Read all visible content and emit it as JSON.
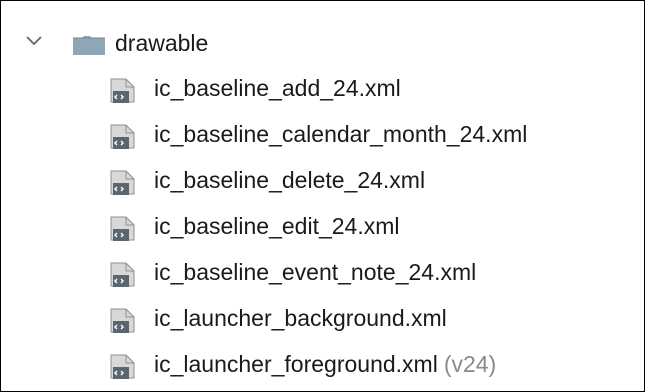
{
  "project_tree": {
    "folder": {
      "expanded": true,
      "label": "drawable",
      "chevron_icon": "chevron-down-icon",
      "folder_icon": "folder-icon"
    },
    "files": [
      {
        "label": "ic_baseline_add_24.xml",
        "icon": "xml-file-icon",
        "qualifier": ""
      },
      {
        "label": "ic_baseline_calendar_month_24.xml",
        "icon": "xml-file-icon",
        "qualifier": ""
      },
      {
        "label": "ic_baseline_delete_24.xml",
        "icon": "xml-file-icon",
        "qualifier": ""
      },
      {
        "label": "ic_baseline_edit_24.xml",
        "icon": "xml-file-icon",
        "qualifier": ""
      },
      {
        "label": "ic_baseline_event_note_24.xml",
        "icon": "xml-file-icon",
        "qualifier": ""
      },
      {
        "label": "ic_launcher_background.xml",
        "icon": "xml-file-icon",
        "qualifier": ""
      },
      {
        "label": "ic_launcher_foreground.xml",
        "icon": "xml-file-icon",
        "qualifier": "(v24)"
      }
    ]
  },
  "colors": {
    "text": "#1a1a1a",
    "qualifier_text": "#8a8a8a",
    "folder_icon": "#8fa6b7",
    "icon_line": "#666666"
  }
}
